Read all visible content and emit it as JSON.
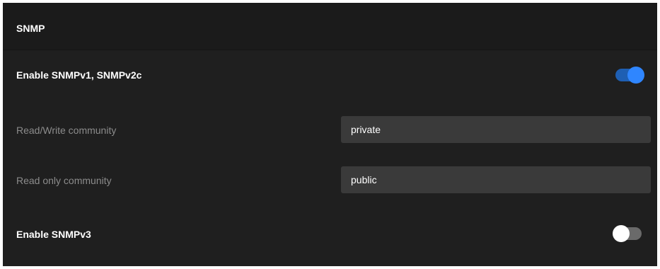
{
  "section": {
    "title": "SNMP"
  },
  "snmp_v1_v2c": {
    "label": "Enable SNMPv1, SNMPv2c",
    "enabled": true
  },
  "read_write_community": {
    "label": "Read/Write community",
    "value": "private"
  },
  "read_only_community": {
    "label": "Read only community",
    "value": "public"
  },
  "snmp_v3": {
    "label": "Enable SNMPv3",
    "enabled": false
  },
  "colors": {
    "panel_background": "#1f1f1f",
    "header_background": "#1b1b1b",
    "input_background": "#3a3a3a",
    "toggle_on_accent": "#2f86ff",
    "toggle_off_track": "#6a6a6a"
  }
}
